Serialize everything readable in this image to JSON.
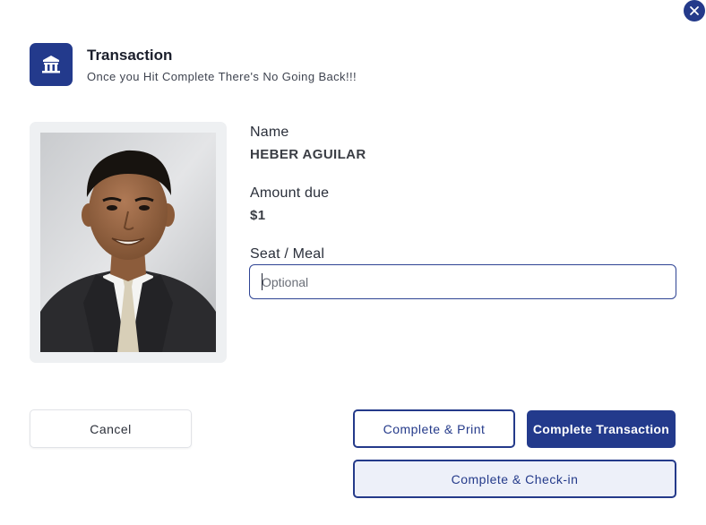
{
  "header": {
    "title": "Transaction",
    "subtitle": "Once you Hit Complete There's No Going Back!!!",
    "icon": "ticket-booth-icon"
  },
  "attendee": {
    "name_label": "Name",
    "name_value": "HEBER AGUILAR",
    "amount_label": "Amount due",
    "amount_value": "$1"
  },
  "seat_meal": {
    "label": "Seat / Meal",
    "value": "",
    "placeholder": "Optional"
  },
  "buttons": {
    "cancel": "Cancel",
    "complete_print": "Complete & Print",
    "complete_transaction": "Complete Transaction",
    "complete_checkin": "Complete & Check-in"
  },
  "colors": {
    "primary": "#233a8c",
    "checkin_bg": "#edf0f9",
    "photo_frame": "#eef0f2"
  }
}
